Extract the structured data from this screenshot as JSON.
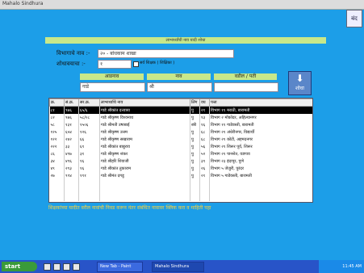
{
  "window": {
    "title": "Mahalo Sindhura"
  },
  "top_right_button": "बंद",
  "panel": {
    "title": "लाभार्थ्यांची नाव यादी शोधा"
  },
  "filters": {
    "label1": "विभागाचे नाव :-",
    "value1": "२० - बांधकाम शाखा",
    "label2": "शोधावयाचा :-",
    "value2": "१",
    "checkbox_label": "सर्व शिक्षक ( शिक्षिका )"
  },
  "columns_header": {
    "surname": "आडनाव",
    "name": "नाव",
    "father_husband": "वडील / पती"
  },
  "inputs": {
    "surname": "गाडे",
    "name": "श्री",
    "father_husband": ""
  },
  "search_button": "शोधा",
  "table": {
    "headers": [
      "क्र.",
      "सं.क्र.",
      "सर.क्र.",
      "लाभार्थ्याचे नाव",
      "लिंग",
      "वय",
      "पत्ता"
    ],
    "rows": [
      [
        "८१",
        "९७६",
        "६५/६",
        "गाडे श्रीकांत दत्तात्रय",
        "पु",
        "२१",
        "विभाग ११ मराठी, बारामती"
      ],
      [
        "८२",
        "९७६",
        "५८/०८",
        "गाडे श्रीकृष्ण विश्वनाथ",
        "पु",
        "१३",
        "विभाग २ मोकोदर, अहिल्यानगर"
      ],
      [
        "५८",
        "१३१",
        "१५०६",
        "गाडे श्रीमती उषाबाई",
        "स्त्री",
        "१६",
        "विभाग ११ गाडेवस्ती, बारामती"
      ],
      [
        "१२५",
        "६५४",
        "१२६",
        "गाडे श्रीकृष्ण उत्तम",
        "पु",
        "६८",
        "विभाग २१ अंधेरीनगर, विद्यार्थी"
      ],
      [
        "१२२",
        "२४२",
        "६६",
        "गाडे श्रीकृष्ण सखाराम",
        "पु",
        "६८",
        "विभाग २१ कोटी, अहमदनगर"
      ],
      [
        "२२२",
        "३३",
        "६९",
        "गाडे श्रीकांत बाबुराव",
        "पु",
        "५६",
        "विभाग २१ शिरूर पूर्व, शिरूर"
      ],
      [
        "८६",
        "४९७",
        "३१",
        "गाडे श्रीकृष्ण शंकर",
        "पु",
        "५२",
        "विभाग २१ पानशेत, वडगाव"
      ],
      [
        "३४",
        "४९६",
        "१६",
        "गाडे श्रीहरि शिवाजी",
        "पु",
        "३९",
        "विभाग २३ इंदापूर, पुणे"
      ],
      [
        "४९",
        "२९३",
        "१६",
        "गाडे श्रीकांत तुकाराम",
        "पु",
        "२६",
        "विभाग ५ जेजुरी, पुरंदर"
      ],
      [
        "२७",
        "९९४",
        "१९१",
        "गाडे श्रीमंत दगडू",
        "पु",
        "२१",
        "विभाग ५ गाडेवस्ती, बारामती"
      ]
    ],
    "selected_row": 0
  },
  "footnote": "शिक्षकांच्या यादीत वरील नावांची निवड करून नंतर संबंधित नावावर क्लिक करा व माहिती पहा",
  "taskbar": {
    "start": "start",
    "tasks": [
      "New Tab - Paint",
      "Mahalo Sindhura"
    ],
    "tray_time": "11:45 AM"
  }
}
